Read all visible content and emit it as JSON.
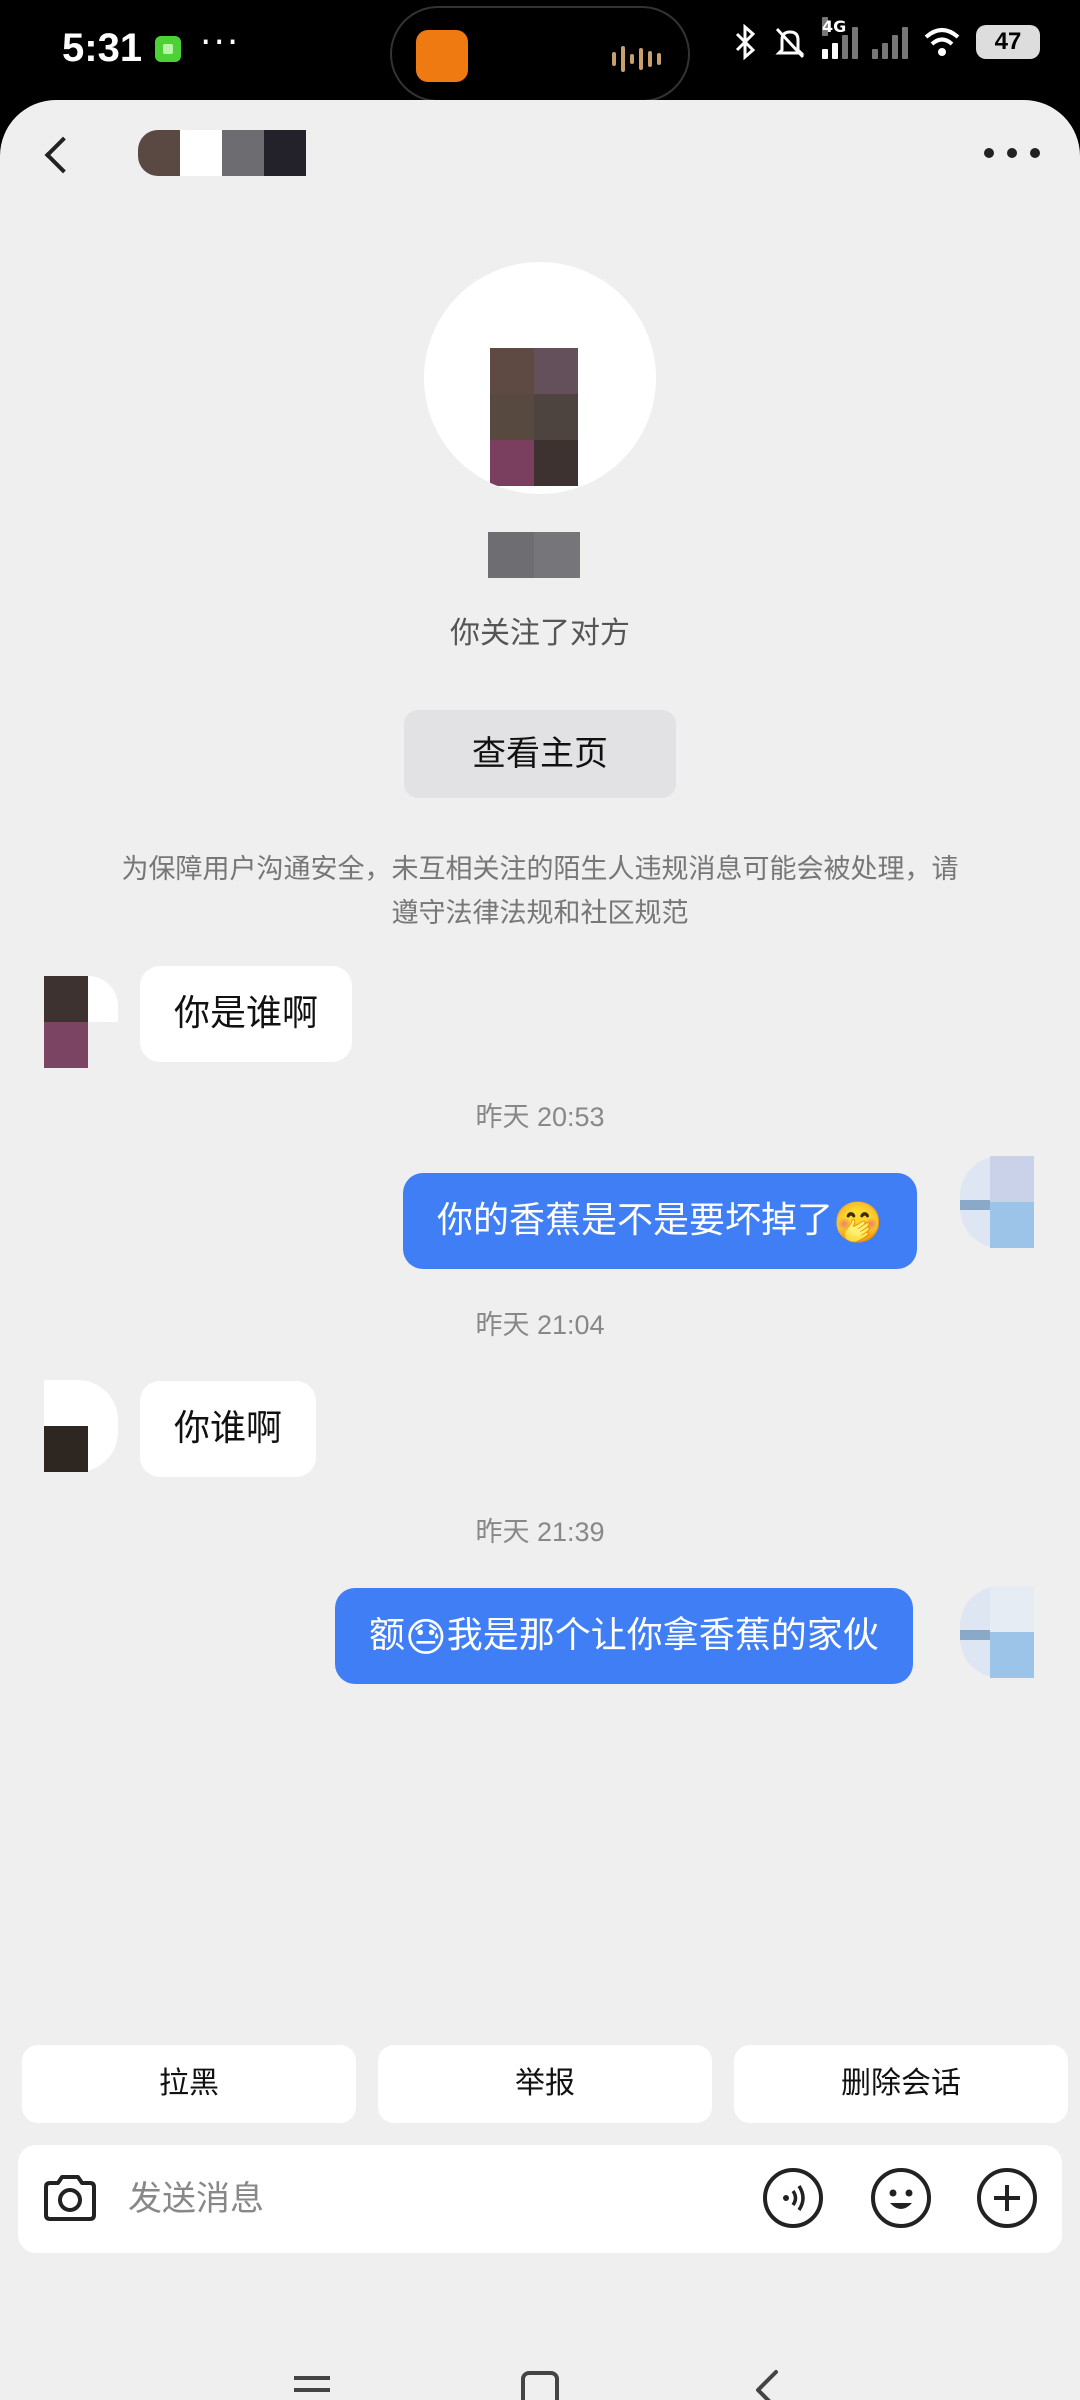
{
  "status_bar": {
    "time": "5:31",
    "more": "···",
    "network": "4G",
    "battery": "47"
  },
  "profile": {
    "follow_status": "你关注了对方",
    "view_profile_label": "查看主页"
  },
  "notice": "为保障用户沟通安全，未互相关注的陌生人违规消息可能会被处理，请遵守法律法规和社区规范",
  "messages": [
    {
      "direction": "in",
      "text": "你是谁啊"
    },
    {
      "timestamp": "昨天 20:53"
    },
    {
      "direction": "out",
      "text": "你的香蕉是不是要坏掉了",
      "emoji": "🤭"
    },
    {
      "timestamp": "昨天 21:04"
    },
    {
      "direction": "in",
      "text": "你谁啊"
    },
    {
      "timestamp": "昨天 21:39"
    },
    {
      "direction": "out",
      "prefix": "额",
      "emoji": "😓",
      "text": "我是那个让你拿香蕉的家伙"
    }
  ],
  "quick_actions": [
    "拉黑",
    "举报",
    "删除会话"
  ],
  "input": {
    "placeholder": "发送消息"
  },
  "icons": {
    "back": "back-arrow-icon",
    "more": "more-dots-icon",
    "camera": "camera-icon",
    "voice": "voice-icon",
    "emoji": "emoji-icon",
    "plus": "plus-icon",
    "nav_menu": "menu-icon",
    "nav_home": "home-icon",
    "nav_back": "back-icon"
  },
  "colors": {
    "out_bubble": "#3f7ef5",
    "background": "#efeff0"
  }
}
